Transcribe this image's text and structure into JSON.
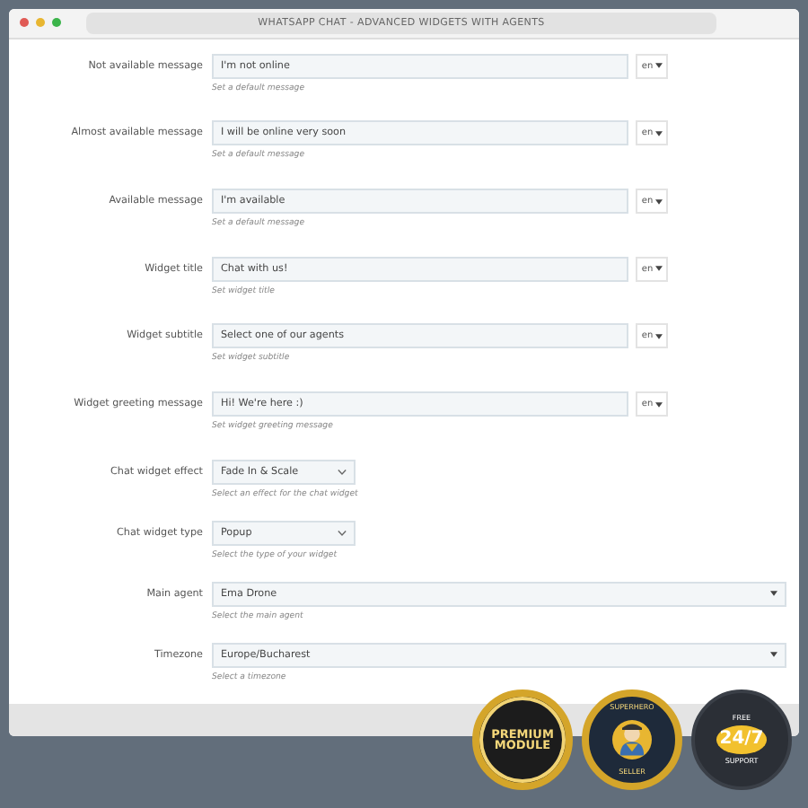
{
  "window": {
    "title": "WHATSAPP CHAT - ADVANCED WIDGETS WITH AGENTS"
  },
  "fields": [
    {
      "kind": "text",
      "label": "Not available message",
      "value": "I'm not online",
      "language": "en",
      "help": "Set a default message"
    },
    {
      "kind": "text",
      "label": "Almost available message",
      "value": "I will be online very soon",
      "language": "en",
      "help": "Set a default message"
    },
    {
      "kind": "text",
      "label": "Available message",
      "value": "I'm available",
      "language": "en",
      "help": "Set a default message"
    },
    {
      "kind": "text",
      "label": "Widget title",
      "value": "Chat with us!",
      "language": "en",
      "help": "Set widget title"
    },
    {
      "kind": "text",
      "label": "Widget subtitle",
      "value": "Select one of our agents",
      "language": "en",
      "help": "Set widget subtitle"
    },
    {
      "kind": "text",
      "label": "Widget greeting message",
      "value": "Hi! We're here :)",
      "language": "en",
      "help": "Set widget greeting message"
    },
    {
      "kind": "short_select",
      "label": "Chat widget effect",
      "value": "Fade In & Scale",
      "help": "Select an effect for the chat widget"
    },
    {
      "kind": "short_select",
      "label": "Chat widget type",
      "value": "Popup",
      "help": "Select the type of your widget"
    },
    {
      "kind": "wide_select",
      "label": "Main agent",
      "value": "Ema Drone",
      "help": "Select the main agent"
    },
    {
      "kind": "wide_select",
      "label": "Timezone",
      "value": "Europe/Bucharest",
      "help": "Select a timezone"
    }
  ],
  "badges": [
    {
      "kind": "premium",
      "lines": [
        "PREMIUM",
        "MODULE"
      ]
    },
    {
      "kind": "seller",
      "lines": [
        "SUPERHERO",
        "SELLER"
      ]
    },
    {
      "kind": "support",
      "lines": [
        "FREE",
        "24/7",
        "SUPPORT"
      ]
    }
  ]
}
